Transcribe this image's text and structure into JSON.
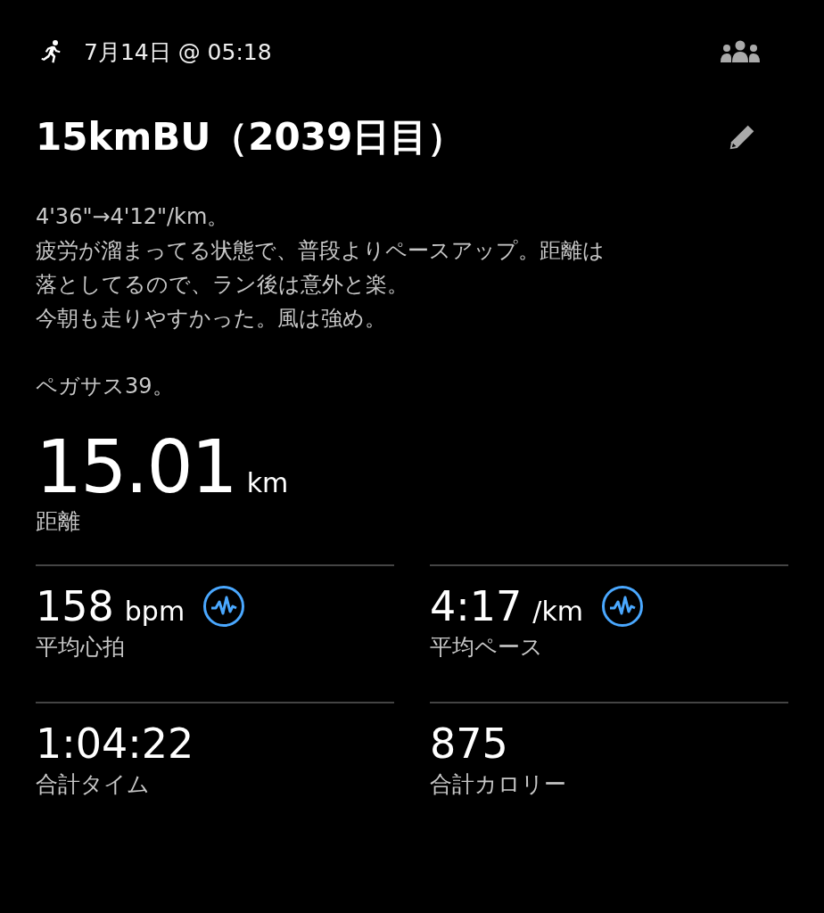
{
  "header": {
    "date": "7月14日 @ 05:18"
  },
  "title": "15kmBU（2039日目）",
  "description": [
    [
      "4'36\"→4'12\"/km。",
      "疲労が溜まってる状態で、普段よりペースアップ。距離は",
      "落としてるので、ラン後は意外と楽。",
      "今朝も走りやすかった。風は強め。"
    ],
    [
      "ペガサス39。"
    ]
  ],
  "distance": {
    "value": "15.01",
    "unit": "km",
    "label": "距離"
  },
  "stats": [
    {
      "value": "158",
      "unit": "bpm",
      "label": "平均心拍",
      "graph_icon": true
    },
    {
      "value": "4:17",
      "unit": "/km",
      "label": "平均ペース",
      "graph_icon": true
    },
    {
      "value": "1:04:22",
      "label": "合計タイム",
      "graph_icon": false
    },
    {
      "value": "875",
      "label": "合計カロリー",
      "graph_icon": false
    }
  ]
}
